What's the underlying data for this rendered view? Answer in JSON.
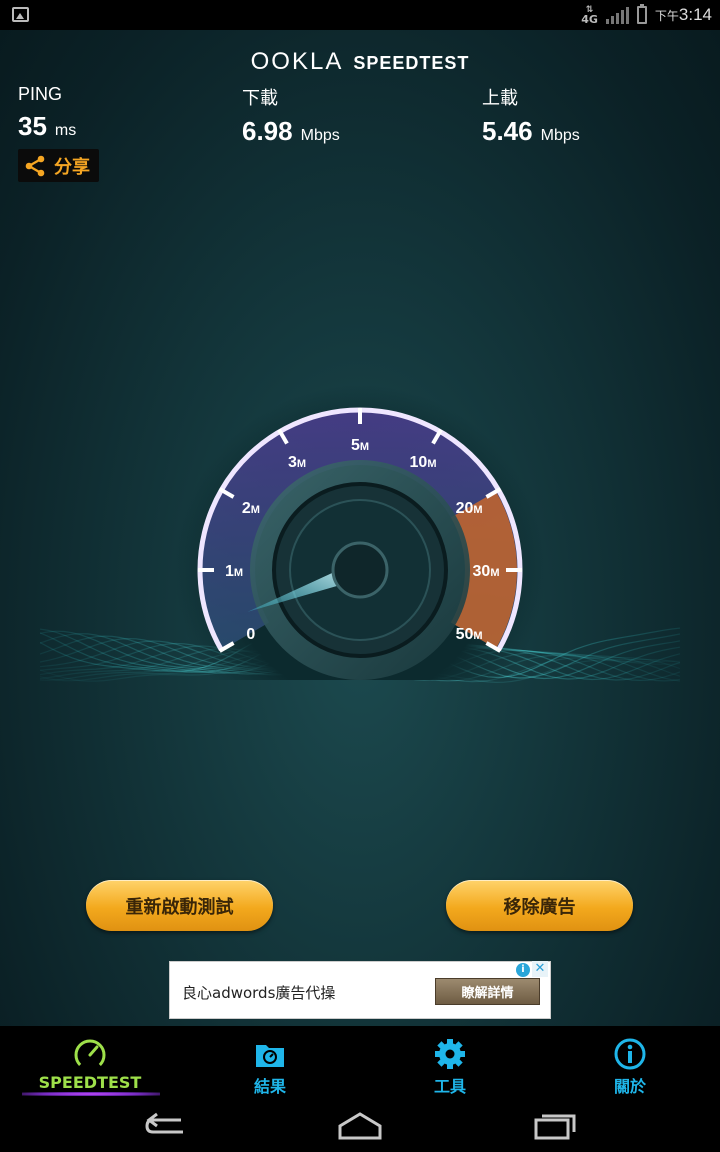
{
  "status_bar": {
    "network": "4G",
    "time_prefix": "下午",
    "time": "3:14"
  },
  "header": {
    "brand": "OOKLA",
    "product": "SPEEDTEST"
  },
  "results": {
    "ping": {
      "label": "PING",
      "value": "35",
      "unit": "ms"
    },
    "download": {
      "label": "下載",
      "value": "6.98",
      "unit": "Mbps"
    },
    "upload": {
      "label": "上載",
      "value": "5.46",
      "unit": "Mbps"
    }
  },
  "share": {
    "label": "分享"
  },
  "gauge": {
    "ticks": [
      "0",
      "1M",
      "2M",
      "3M",
      "5M",
      "10M",
      "20M",
      "30M",
      "50M"
    ],
    "needle_value_fraction": 0.04,
    "colors": {
      "arc": "#c9a9ff",
      "hot_zone": "#e07a3a",
      "needle": "#bff6ff"
    }
  },
  "actions": {
    "restart_label": "重新啟動測試",
    "remove_ads_label": "移除廣告"
  },
  "ad": {
    "text": "良心adwords廣告代操",
    "cta": "瞭解詳情",
    "info": "i",
    "close": "✕"
  },
  "tabs": [
    {
      "label": "SPEEDTEST",
      "icon": "speedometer-icon",
      "active": true
    },
    {
      "label": "結果",
      "icon": "results-folder-icon",
      "active": false
    },
    {
      "label": "工具",
      "icon": "gear-icon",
      "active": false
    },
    {
      "label": "關於",
      "icon": "info-icon",
      "active": false
    }
  ],
  "colors": {
    "accent": "#1fb6ea",
    "active_tab": "#9ee04a",
    "button": "#f3a91d",
    "share_text": "#f6a623"
  }
}
